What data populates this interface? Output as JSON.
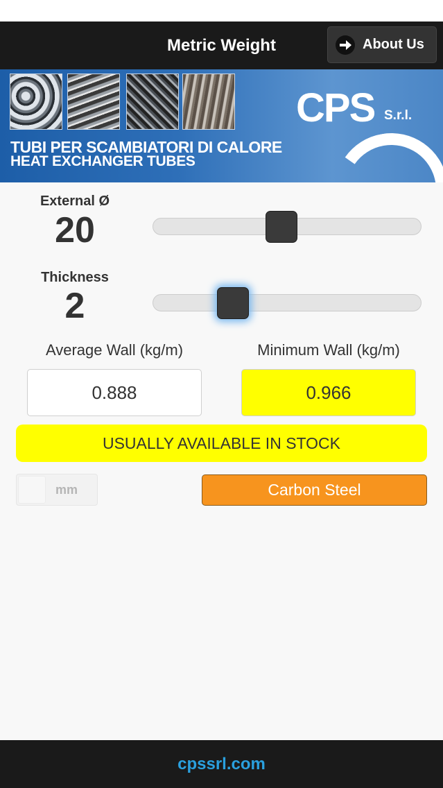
{
  "header": {
    "title": "Metric Weight",
    "about_label": "About Us",
    "about_icon": "arrow-right-icon"
  },
  "banner": {
    "line1": "TUBI PER SCAMBIATORI DI CALORE",
    "line2": "HEAT EXCHANGER TUBES",
    "logo": "CPS",
    "logo_suffix": "S.r.l."
  },
  "external": {
    "label": "External Ø",
    "value": "20",
    "slider_fraction": 0.48
  },
  "thickness": {
    "label": "Thickness",
    "value": "2",
    "slider_fraction": 0.3
  },
  "results": {
    "average_label": "Average Wall (kg/m)",
    "average_value": "0.888",
    "minimum_label": "Minimum Wall (kg/m)",
    "minimum_value": "0.966"
  },
  "stock_status": "USUALLY AVAILABLE IN STOCK",
  "unit_toggle": {
    "label": "mm",
    "on": false
  },
  "material": {
    "label": "Carbon Steel"
  },
  "footer": {
    "link": "cpssrl.com"
  },
  "colors": {
    "highlight": "#ffff00",
    "material": "#f7941e",
    "link": "#2aa0de",
    "bar": "#1a1a1a"
  }
}
